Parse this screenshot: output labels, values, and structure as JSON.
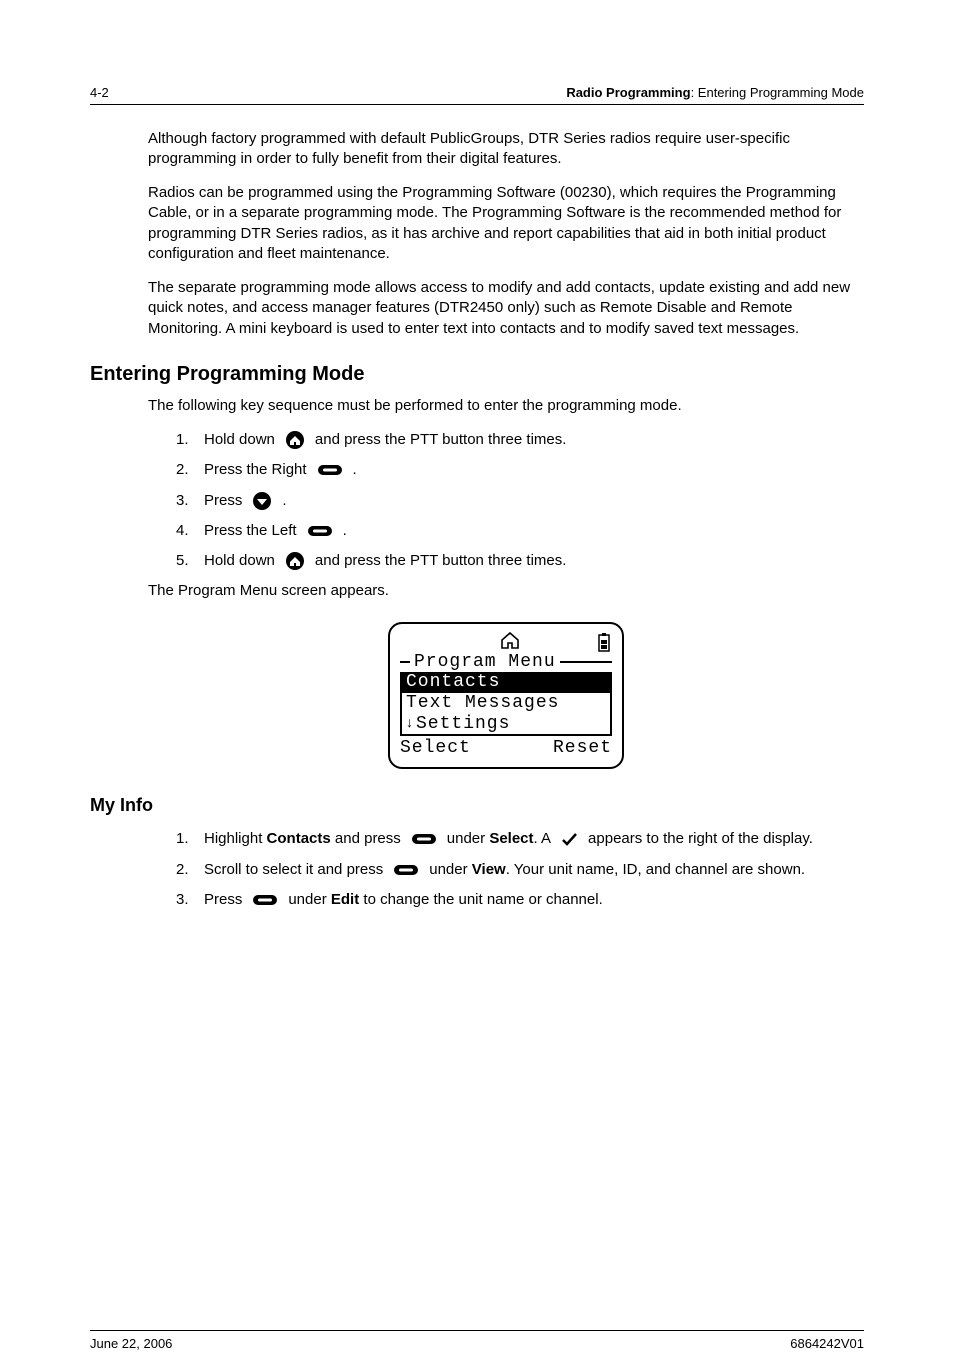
{
  "header": {
    "page_num": "4-2",
    "chapter": "Radio Programming",
    "section_path": "Entering Programming Mode"
  },
  "intro": {
    "p1": "Although factory programmed with default PublicGroups, DTR Series radios require user-specific programming in order to fully benefit from their digital features.",
    "p2": "Radios can be programmed using the Programming Software (00230), which requires the Programming Cable, or in a separate programming mode. The Programming Software is the recommended method for programming DTR Series radios, as it has archive and report capabilities that aid in both initial product configuration and fleet maintenance.",
    "p3": "The separate programming mode allows access to modify and add contacts, update existing and add new quick notes, and access manager features (DTR2450 only) such as Remote Disable and Remote Monitoring. A mini keyboard is used to enter text into contacts and to modify saved text messages."
  },
  "s1": {
    "title": "Entering Programming Mode",
    "lead": "The following key sequence must be performed to enter the programming mode.",
    "steps": [
      {
        "pre": "Hold down ",
        "icon": "home-icon",
        "post": " and press the PTT button three times."
      },
      {
        "pre": "Press the Right ",
        "icon": "softkey-icon",
        "post": " ."
      },
      {
        "pre": "Press ",
        "icon": "down-nav-icon",
        "post": " ."
      },
      {
        "pre": "Press the Left ",
        "icon": "softkey-icon",
        "post": " ."
      },
      {
        "pre": "Hold down ",
        "icon": "home-icon",
        "post": " and press the PTT button three times."
      }
    ],
    "after": "The Program Menu screen appears."
  },
  "phone": {
    "menu_title": "Program Menu",
    "items": [
      "Contacts",
      "Text Messages",
      "Settings"
    ],
    "soft_left": "Select",
    "soft_right": "Reset"
  },
  "s2": {
    "title": "My Info",
    "steps": {
      "s1a": "Highlight ",
      "s1b_bold": "Contacts",
      "s1c": " and press ",
      "s1d": " under ",
      "s1e_bold": "Select",
      "s1f": ". A ",
      "s1g": " appears to the right of the display.",
      "s2a": "Scroll to select it and press ",
      "s2b": " under ",
      "s2c_bold": "View",
      "s2d": ". Your unit name, ID, and channel are shown.",
      "s3a": "Press ",
      "s3b": " under ",
      "s3c_bold": "Edit",
      "s3d": " to change the unit name or channel."
    }
  },
  "footer": {
    "date": "June 22, 2006",
    "docnum": "6864242V01"
  }
}
